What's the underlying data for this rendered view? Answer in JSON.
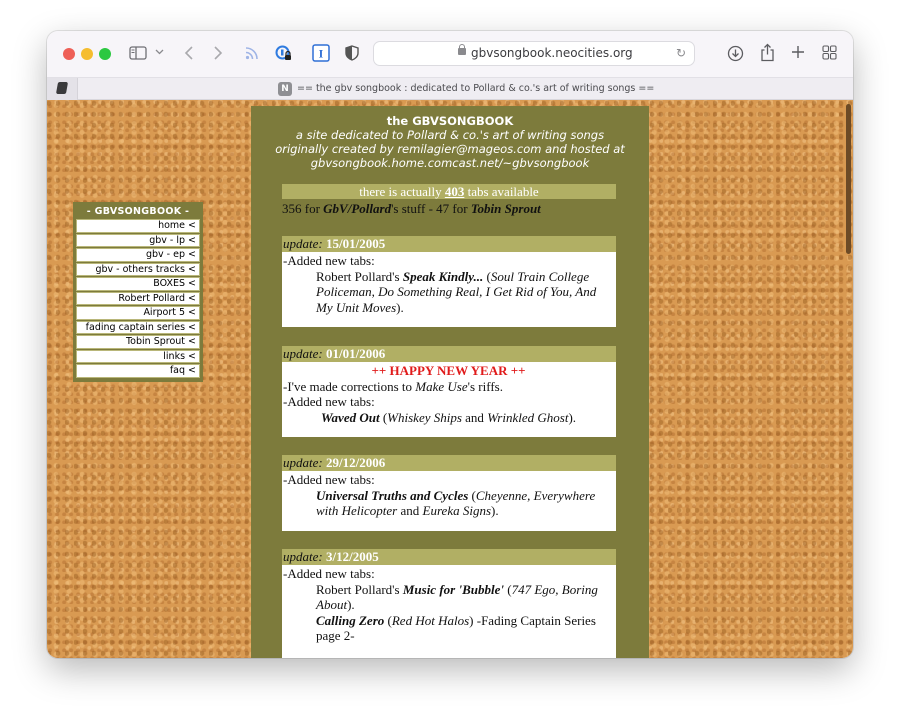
{
  "browser": {
    "url": "gbvsongbook.neocities.org",
    "tab_title": "== the gbv songbook : dedicated to Pollard & co.'s art of writing songs ==",
    "favicon_letter": "N",
    "toolbar_icons": [
      "sidebar-icon",
      "chevron-down-icon",
      "back-icon",
      "forward-icon",
      "rss-icon",
      "privacy-lock-icon",
      "text-cursor-icon",
      "shield-icon",
      "download-icon",
      "share-icon",
      "new-tab-icon",
      "tab-overview-icon"
    ]
  },
  "nav": {
    "title": "- GBVSONGBOOK -",
    "items": [
      {
        "label": "home <"
      },
      {
        "label": "gbv - lp <"
      },
      {
        "label": "gbv - ep <"
      },
      {
        "label": "gbv - others tracks <"
      },
      {
        "label": "BOXES <"
      },
      {
        "label": "Robert Pollard <"
      },
      {
        "label": "Airport 5 <"
      },
      {
        "label": "fading captain series <"
      },
      {
        "label": "Tobin Sprout <"
      },
      {
        "label": "links <"
      },
      {
        "label": "faq <"
      }
    ]
  },
  "header": {
    "title": "the GBVSONGBOOK",
    "line1": "a site dedicated to Pollard & co.'s art of writing songs",
    "line2": "originally created by remilagier@mageos.com and hosted at",
    "line3": "gbvsongbook.home.comcast.net/~gbvsongbook"
  },
  "tabcount": {
    "prefix": "there is actually ",
    "count": "403",
    "suffix": " tabs available"
  },
  "breakdown": {
    "gbv_count": "356 for ",
    "gbv_label": "GbV/Pollard",
    "gbv_suffix": "'s stuff - 47 for ",
    "tobin_label": "Tobin Sprout"
  },
  "updates": [
    {
      "label": "update:",
      "date": "15/01/2005",
      "intro": "-Added new tabs:",
      "prefix": "Robert Pollard's ",
      "album": "Speak Kindly...",
      "songs": "Soul Train College Policeman, Do Something Real, I Get Rid of You, And My Unit Moves"
    },
    {
      "label": "update:",
      "date": "01/01/2006",
      "banner": "++ HAPPY NEW YEAR ++",
      "line1_prefix": "-I've made corrections to ",
      "line1_title": "Make Use",
      "line1_suffix": "'s riffs.",
      "intro": "-Added new tabs:",
      "album": "Waved Out",
      "song1": "Whiskey Ships",
      "song2": "Wrinkled Ghost"
    },
    {
      "label": "update:",
      "date": "29/12/2006",
      "intro": "-Added new tabs:",
      "album": "Universal Truths and Cycles",
      "song1": "Cheyenne, Everywhere with Helicopter",
      "song2": "Eureka Signs"
    },
    {
      "label": "update:",
      "date": "3/12/2005",
      "intro": "-Added new tabs:",
      "prefix": "Robert Pollard's ",
      "album": "Music for 'Bubble'",
      "songs": "747 Ego, Boring About",
      "album2": "Calling Zero",
      "songs2": "Red Hot Halos",
      "suffix2": " -Fading Captain Series page 2-"
    }
  ],
  "colors": {
    "panel_olive": "#7d7b3c",
    "header_bar": "#b1af64",
    "happy_new_year_red": "#e01b1b",
    "cork": "#d99a52"
  }
}
